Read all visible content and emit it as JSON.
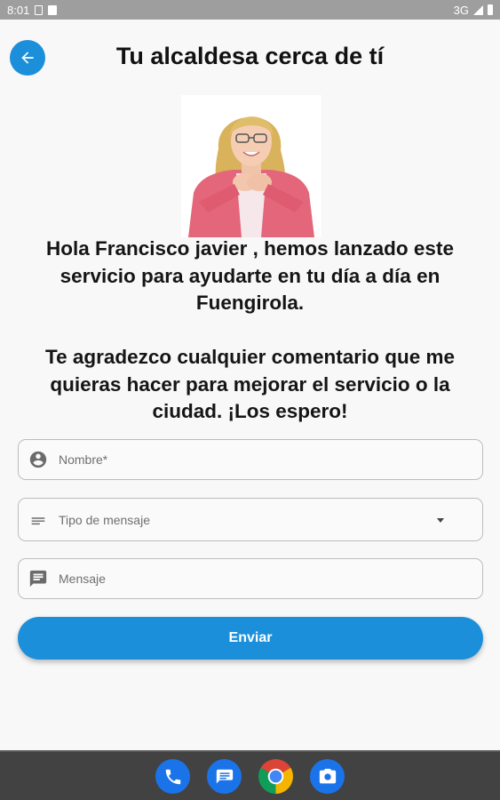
{
  "status_bar": {
    "time": "8:01",
    "network": "3G"
  },
  "header": {
    "title": "Tu alcaldesa cerca de tí",
    "back_icon": "arrow-back-icon"
  },
  "intro": {
    "paragraph_1": "Hola Francisco javier , hemos lanzado este servicio para ayudarte en tu día a día en Fuengirola.",
    "paragraph_2": "Te agradezco cualquier comentario que me quieras hacer para mejorar el servicio o la ciudad. ¡Los espero!"
  },
  "form": {
    "name_placeholder": "Nombre*",
    "type_placeholder": "Tipo de mensaje",
    "message_placeholder": "Mensaje",
    "submit_label": "Enviar"
  },
  "dock": {
    "apps": [
      "phone-icon",
      "messages-icon",
      "chrome-icon",
      "camera-icon"
    ]
  },
  "colors": {
    "accent": "#1c8fdb",
    "background": "#f8f8f8",
    "dock": "#424242",
    "status_bar": "#9e9e9e"
  }
}
